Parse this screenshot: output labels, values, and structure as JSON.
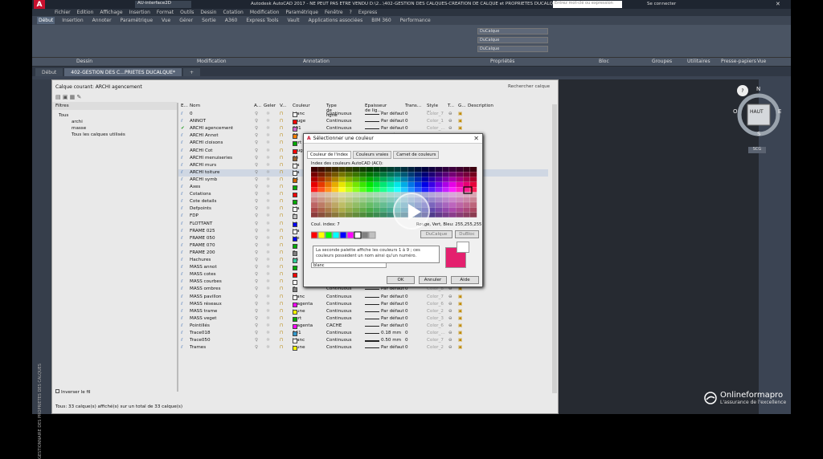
{
  "app": {
    "title": "Autodesk AutoCAD 2017 - NE PEUT PAS ETRE VENDU   D:\\2...\\402-GESTION DES CALQUES-CREATION DE CALQUE et PROPRIETES DUCALQUE.dwg",
    "workspace": "AU-interface2D",
    "search_placeholder": "Entrez mot-clé ou expression",
    "signin": "Se connecter"
  },
  "menu": [
    "Fichier",
    "Edition",
    "Affichage",
    "Insertion",
    "Format",
    "Outils",
    "Dessin",
    "Cotation",
    "Modification",
    "Paramétrique",
    "Fenêtre",
    "?",
    "Express"
  ],
  "ribbon_tabs": [
    "Début",
    "Insertion",
    "Annoter",
    "Paramétrique",
    "Vue",
    "Gérer",
    "Sortie",
    "A360",
    "Express Tools",
    "Vault",
    "Applications associées",
    "BIM 360",
    "Performance"
  ],
  "ribbon_panels": [
    "Dessin",
    "Modification",
    "Annotation",
    "Propriétés",
    "Bloc",
    "Groupes",
    "Utilitaires",
    "Presse-papiers",
    "Vue"
  ],
  "ribbon_props": {
    "color": "DuCalque",
    "linetype": "DuCalque",
    "lineweight": "DuCalque"
  },
  "doc_tabs": [
    "Début",
    "402-GESTION DES C...PRIETES DUCALQUE*"
  ],
  "palette": {
    "current_layer": "Calque courant: ARCHI agencement",
    "search": "Rechercher calque",
    "filters_label": "Filtres",
    "tree": [
      "Tous",
      "archi",
      "masse",
      "Tous les calques utilisés"
    ],
    "invert_filter": "Inverser le fil",
    "status": "Tous: 33 calque(s) affiché(s) sur un total de 33 calque(s)",
    "vertical_title": "GESTIONNAIRE DES PROPRIETES DES CALQUES"
  },
  "columns": [
    "E...",
    "Nom",
    "A...",
    "Geler",
    "V...",
    "Couleur",
    "Type de ligne",
    "Epaisseur de lig...",
    "Trans...",
    "Style ...",
    "T...",
    "G...",
    "Description"
  ],
  "layers": [
    {
      "name": "0",
      "color": "blanc",
      "hex": "#ffffff",
      "lt": "Continuous",
      "lw": "Par défaut",
      "tr": "0",
      "st": "Color_7"
    },
    {
      "name": "ANNOT",
      "color": "rouge",
      "hex": "#ff0000",
      "lt": "Continuous",
      "lw": "Par défaut",
      "tr": "0",
      "st": "Color_1"
    },
    {
      "name": "ARCHI agencement",
      "color": "201",
      "hex": "#cc66cc",
      "lt": "Continuous",
      "lw": "Par défaut",
      "tr": "0",
      "st": "Color_..."
    },
    {
      "name": "ARCHI Annot",
      "color": "30",
      "hex": "#ff7f00",
      "lt": "Continuous",
      "lw": "Par défaut",
      "tr": "0",
      "st": "Color_..."
    },
    {
      "name": "ARCHI cloisons",
      "color": "vert",
      "hex": "#00aa00",
      "lt": "Continuous",
      "lw": "Par défaut",
      "tr": "0",
      "st": "Color_..."
    },
    {
      "name": "ARCHI Cot",
      "color": "rouge",
      "hex": "#ff0000",
      "lt": "Continuous",
      "lw": "Par défaut",
      "tr": "0",
      "st": "Color_..."
    },
    {
      "name": "ARCHI menuiseries",
      "color": "33",
      "hex": "#996633",
      "lt": "Continuous",
      "lw": "Par défaut",
      "tr": "0",
      "st": "Color_..."
    },
    {
      "name": "ARCHI murs",
      "color": "bla",
      "hex": "#ffffff",
      "lt": "Continuous",
      "lw": "Par défaut",
      "tr": "0",
      "st": "Color_..."
    },
    {
      "name": "ARCHI toiture",
      "color": "bla",
      "hex": "#ffffff",
      "lt": "Continuous",
      "lw": "Par défaut",
      "tr": "0",
      "st": "Color_..."
    },
    {
      "name": "ARCHI symb",
      "color": "14",
      "hex": "#cc6600",
      "lt": "Continuous",
      "lw": "Par défaut",
      "tr": "0",
      "st": "Color_..."
    },
    {
      "name": "Axes",
      "color": "ve",
      "hex": "#00aa00",
      "lt": "Continuous",
      "lw": "Par défaut",
      "tr": "0",
      "st": "Color_..."
    },
    {
      "name": "Cotations",
      "color": "ro",
      "hex": "#ff0000",
      "lt": "Continuous",
      "lw": "Par défaut",
      "tr": "0",
      "st": "Color_..."
    },
    {
      "name": "Cote details",
      "color": "ve",
      "hex": "#00aa00",
      "lt": "Continuous",
      "lw": "Par défaut",
      "tr": "0",
      "st": "Color_..."
    },
    {
      "name": "Defpoints",
      "color": "bla",
      "hex": "#ffffff",
      "lt": "Continuous",
      "lw": "Par défaut",
      "tr": "0",
      "st": "Color_..."
    },
    {
      "name": "FDP",
      "color": "9",
      "hex": "#c0c0c0",
      "lt": "Continuous",
      "lw": "Par défaut",
      "tr": "0",
      "st": "Color_..."
    },
    {
      "name": "FLOTTANT",
      "color": "bl",
      "hex": "#0000ff",
      "lt": "Continuous",
      "lw": "Par défaut",
      "tr": "0",
      "st": "Color_..."
    },
    {
      "name": "FRAME 025",
      "color": "bla",
      "hex": "#ffffff",
      "lt": "Continuous",
      "lw": "Par défaut",
      "tr": "0",
      "st": "Color_..."
    },
    {
      "name": "FRAME 050",
      "color": "ble",
      "hex": "#0000ff",
      "lt": "Continuous",
      "lw": "Par défaut",
      "tr": "0",
      "st": "Color_..."
    },
    {
      "name": "FRAME 070",
      "color": "ve",
      "hex": "#00aa00",
      "lt": "Continuous",
      "lw": "Par défaut",
      "tr": "0",
      "st": "Color_..."
    },
    {
      "name": "FRAME 200",
      "color": "8",
      "hex": "#808080",
      "lt": "Continuous",
      "lw": "Par défaut",
      "tr": "0",
      "st": "Color_..."
    },
    {
      "name": "Hachures",
      "color": "13",
      "hex": "#33cc99",
      "lt": "Continuous",
      "lw": "Par défaut",
      "tr": "0",
      "st": "Color_..."
    },
    {
      "name": "MASS annot",
      "color": "ve",
      "hex": "#00aa00",
      "lt": "Continuous",
      "lw": "Par défaut",
      "tr": "0",
      "st": "Color_..."
    },
    {
      "name": "MASS cotes",
      "color": "ro",
      "hex": "#ff0000",
      "lt": "Continuous",
      "lw": "Par défaut",
      "tr": "0",
      "st": "Color_..."
    },
    {
      "name": "MASS courbes",
      "color": "",
      "hex": "#ffffff",
      "lt": "Continuous",
      "lw": "Par défaut",
      "tr": "0",
      "st": "Color_..."
    },
    {
      "name": "MASS ombres",
      "color": "8",
      "hex": "#808080",
      "lt": "Continuous",
      "lw": "Par défaut",
      "tr": "0",
      "st": "Color_8"
    },
    {
      "name": "MASS pavillon",
      "color": "blanc",
      "hex": "#ffffff",
      "lt": "Continuous",
      "lw": "Par défaut",
      "tr": "0",
      "st": "Color_7"
    },
    {
      "name": "MASS réseaux",
      "color": "magenta",
      "hex": "#ff00ff",
      "lt": "Continuous",
      "lw": "Par défaut",
      "tr": "0",
      "st": "Color_6"
    },
    {
      "name": "MASS trame",
      "color": "jaune",
      "hex": "#ffff00",
      "lt": "Continuous",
      "lw": "Par défaut",
      "tr": "0",
      "st": "Color_2"
    },
    {
      "name": "MASS veget",
      "color": "vert",
      "hex": "#00aa00",
      "lt": "Continuous",
      "lw": "Par défaut",
      "tr": "0",
      "st": "Color_3"
    },
    {
      "name": "Pointillés",
      "color": "magenta",
      "hex": "#ff00ff",
      "lt": "CACHE",
      "lw": "Par défaut",
      "tr": "0",
      "st": "Color_6"
    },
    {
      "name": "Trace018",
      "color": "141",
      "hex": "#3399cc",
      "lt": "Continuous",
      "lw": "0.18 mm",
      "tr": "0",
      "st": "Color_..."
    },
    {
      "name": "Trace050",
      "color": "blanc",
      "hex": "#ffffff",
      "lt": "Continuous",
      "lw": "0.50 mm",
      "tr": "0",
      "st": "Color_7"
    },
    {
      "name": "Trames",
      "color": "jaune",
      "hex": "#ffff00",
      "lt": "Continuous",
      "lw": "Par défaut",
      "tr": "0",
      "st": "Color_2"
    }
  ],
  "dialog": {
    "title": "Sélectionner une couleur",
    "tabs": [
      "Couleur de l'index",
      "Couleurs vraies",
      "Carnet de couleurs"
    ],
    "aci_label": "Index des couleurs AutoCAD (ACI):",
    "index_label": "Coul. index: 7",
    "rgb_label": "Rouge, Vert, Bleu: 255,255,255",
    "bylayer": "DuCalque",
    "byblock": "DuBloc",
    "color_field": "blanc",
    "tooltip": "La seconde palette affiche les couleurs 1 à 9 ; ces couleurs possèdent un nom ainsi qu'un numéro.",
    "ok": "OK",
    "cancel": "Annuler",
    "help": "Aide",
    "preview_color": "#e4206e"
  },
  "viewcube": {
    "top": "HAUT",
    "n": "N",
    "s": "S",
    "e": "E",
    "o": "O",
    "wcs": "SCG"
  },
  "watermark": {
    "brand": "Onlineformapro",
    "tagline": "L'assurance de l'excellence"
  }
}
